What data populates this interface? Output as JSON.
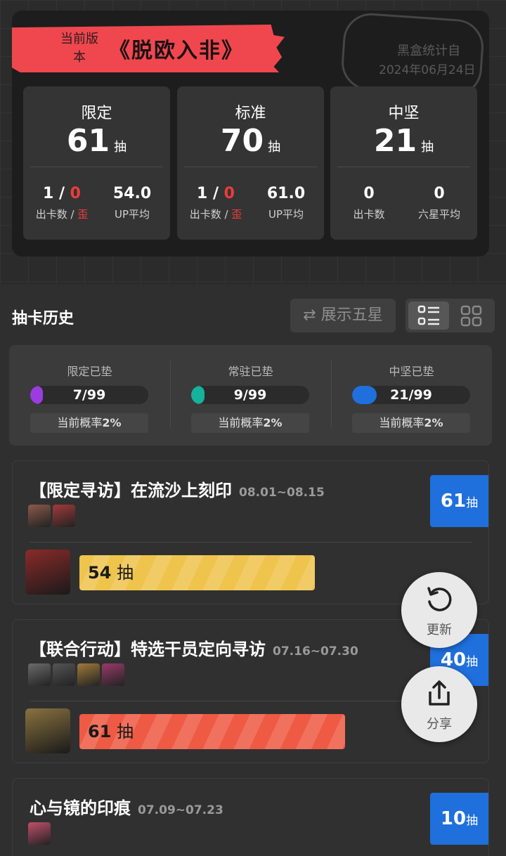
{
  "header": {
    "banner_sub": "当前版本",
    "banner_title": "《脱欧入非》",
    "stamp_title": "黑盒统计自",
    "stamp_date": "2024年06月24日"
  },
  "panels": [
    {
      "title": "限定",
      "count": "61",
      "unit": "抽",
      "s1_a": "1",
      "s1_sep": " / ",
      "s1_b": "0",
      "s1_label_a": "出卡数 / ",
      "s1_label_b": "歪",
      "s2_value": "54.0",
      "s2_label": "UP平均"
    },
    {
      "title": "标准",
      "count": "70",
      "unit": "抽",
      "s1_a": "1",
      "s1_sep": " / ",
      "s1_b": "0",
      "s1_label_a": "出卡数 / ",
      "s1_label_b": "歪",
      "s2_value": "61.0",
      "s2_label": "UP平均"
    },
    {
      "title": "中坚",
      "count": "21",
      "unit": "抽",
      "s1_a": "0",
      "s1_sep": "",
      "s1_b": "",
      "s1_label_a": "出卡数",
      "s1_label_b": "",
      "s2_value": "0",
      "s2_label": "六星平均"
    }
  ],
  "history": {
    "title": "抽卡历史",
    "toggle_label": "⇄ 展示五星"
  },
  "pity": [
    {
      "label": "限定已垫",
      "value": "7/99",
      "fraction": 0.07,
      "color": "#9b3ce0",
      "rate_prefix": "当前概率",
      "rate": "2%"
    },
    {
      "label": "常驻已垫",
      "value": "9/99",
      "fraction": 0.09,
      "color": "#16b29a",
      "rate_prefix": "当前概率",
      "rate": "2%"
    },
    {
      "label": "中坚已垫",
      "value": "21/99",
      "fraction": 0.21,
      "color": "#1f6fdc",
      "rate_prefix": "当前概率",
      "rate": "2%"
    }
  ],
  "pools": [
    {
      "name": "【限定寻访】在流沙上刻印",
      "date": "08.01~08.15",
      "badge_num": "61",
      "badge_unit": "抽",
      "bar_num": "54",
      "bar_unit": "抽",
      "bar_fraction": 0.54,
      "bar_color": "#efc44d",
      "thumb_colors": [
        "#8b5a4a",
        "#a33a3a"
      ],
      "avatar_color": "#8b2a2a"
    },
    {
      "name": "【联合行动】特选干员定向寻访",
      "date": "07.16~07.30",
      "badge_num": "40",
      "badge_unit": "抽",
      "bar_num": "61",
      "bar_unit": "抽",
      "bar_fraction": 0.61,
      "bar_color": "#ee5a43",
      "thumb_colors": [
        "#6b6b6b",
        "#555",
        "#a07a3a",
        "#9a3a6a"
      ],
      "avatar_color": "#8a7240"
    },
    {
      "name": "心与镜的印痕",
      "date": "07.09~07.23",
      "badge_num": "10",
      "badge_unit": "抽",
      "thumb_colors": [
        "#c0506a"
      ]
    }
  ],
  "fabs": {
    "refresh_label": "更新",
    "share_label": "分享"
  }
}
